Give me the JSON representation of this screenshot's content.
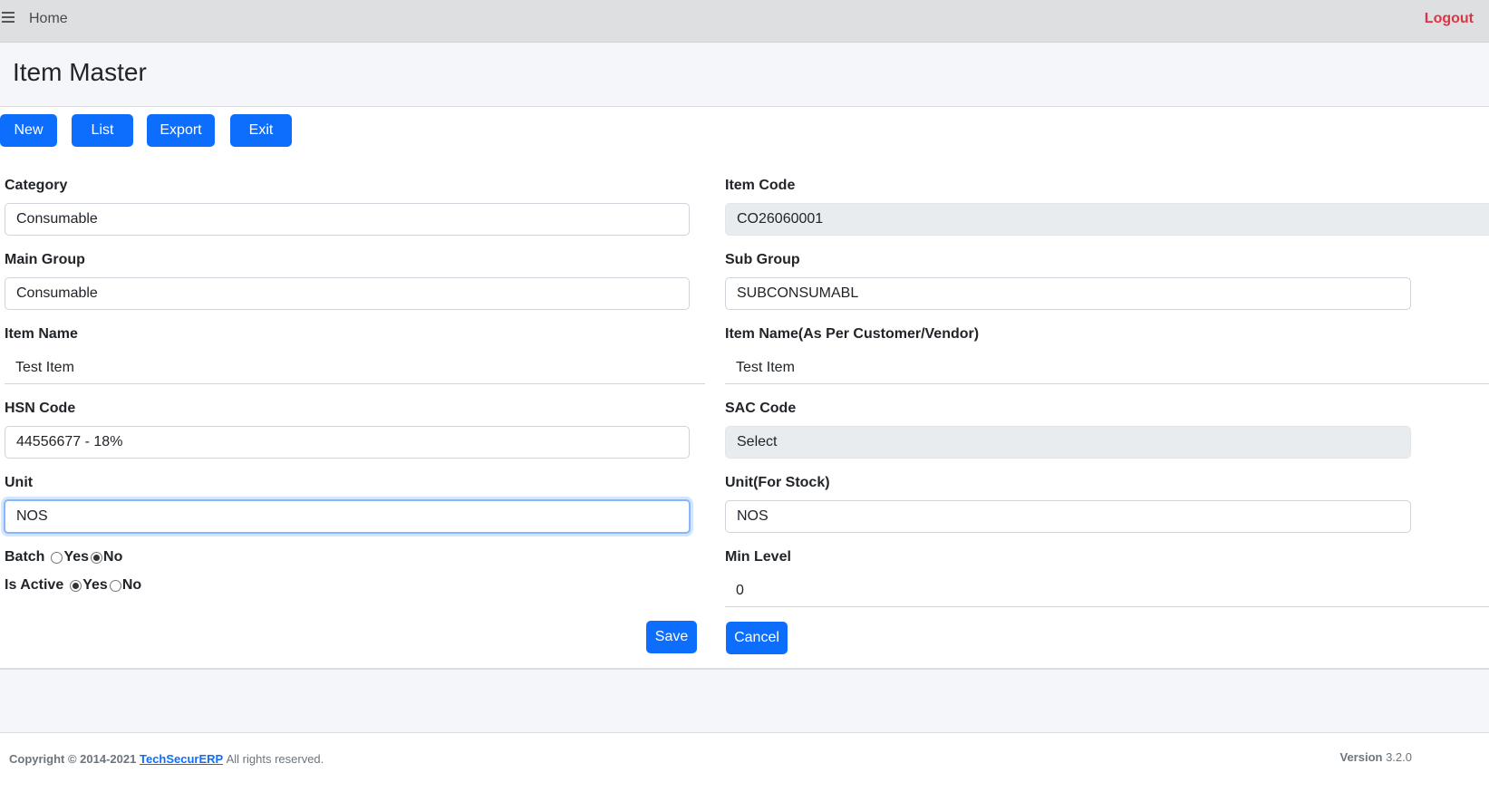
{
  "nav": {
    "home_label": "Home",
    "logout_label": "Logout"
  },
  "page": {
    "title": "Item Master"
  },
  "toolbar": {
    "new_label": "New",
    "list_label": "List",
    "export_label": "Export",
    "exit_label": "Exit"
  },
  "form": {
    "category": {
      "label": "Category",
      "value": "Consumable"
    },
    "item_code": {
      "label": "Item Code",
      "value": "CO26060001"
    },
    "main_group": {
      "label": "Main Group",
      "value": "Consumable"
    },
    "sub_group": {
      "label": "Sub Group",
      "value": "SUBCONSUMABL"
    },
    "item_name": {
      "label": "Item Name",
      "value": "Test Item"
    },
    "item_name_customer": {
      "label": "Item Name(As Per Customer/Vendor)",
      "value": "Test Item"
    },
    "hsn_code": {
      "label": "HSN Code",
      "value": "44556677 - 18%"
    },
    "sac_code": {
      "label": "SAC Code",
      "value": "Select"
    },
    "unit": {
      "label": "Unit",
      "value": "NOS"
    },
    "unit_stock": {
      "label": "Unit(For Stock)",
      "value": "NOS"
    },
    "batch": {
      "label": "Batch",
      "yes_label": "Yes",
      "no_label": "No",
      "selected": "No"
    },
    "is_active": {
      "label": "Is Active",
      "yes_label": "Yes",
      "no_label": "No",
      "selected": "Yes"
    },
    "min_level": {
      "label": "Min Level",
      "value": "0"
    },
    "save_label": "Save",
    "cancel_label": "Cancel"
  },
  "footer": {
    "copyright_prefix": "Copyright © 2014-2021",
    "brand_link": "TechSecurERP",
    "rights": "All rights reserved.",
    "version_label": "Version",
    "version_value": "3.2.0"
  },
  "colors": {
    "primary": "#0d6efd",
    "logout": "#dc3545",
    "topbar": "#dedfe1",
    "band": "#f4f6f9",
    "readonly_field": "#e9ecef"
  }
}
